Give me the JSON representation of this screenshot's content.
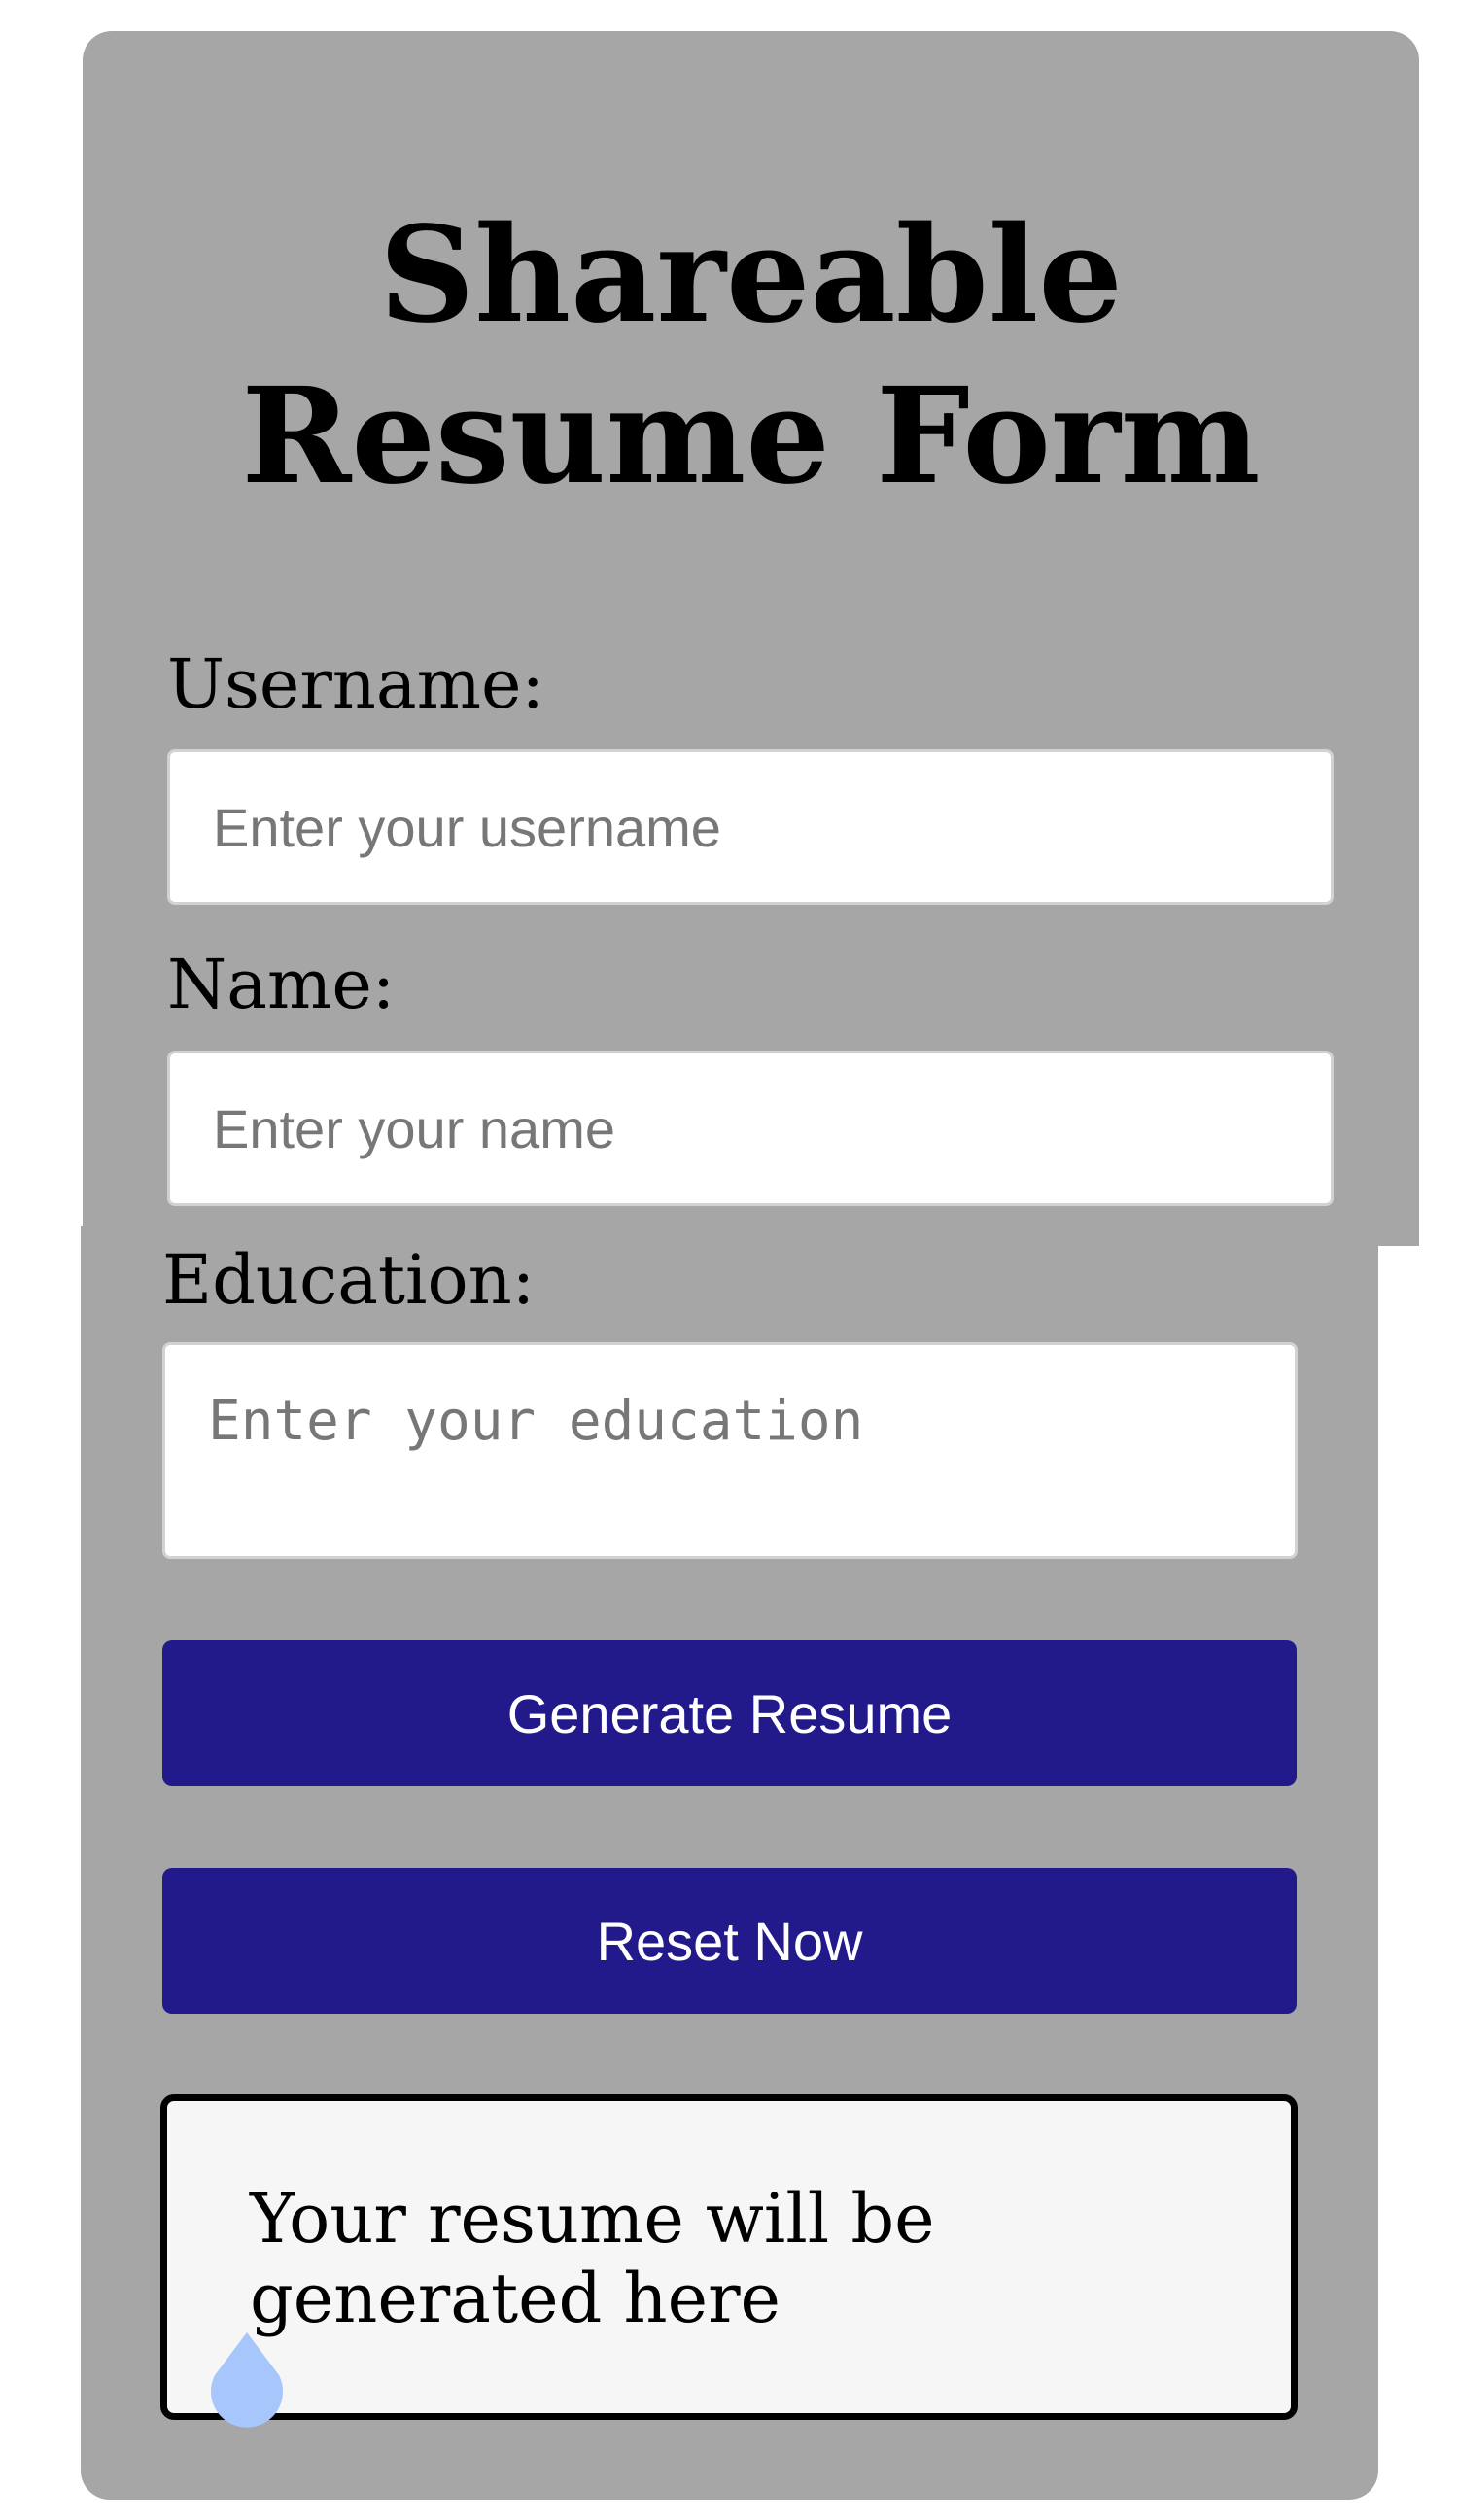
{
  "form": {
    "title": "Shareable Resume Form",
    "username": {
      "label": "Username:",
      "placeholder": "Enter your username",
      "value": ""
    },
    "name": {
      "label": "Name:",
      "placeholder": "Enter your name",
      "value": ""
    },
    "education": {
      "label": "Education:",
      "placeholder": "Enter your education",
      "value": ""
    },
    "generate_button": "Generate Resume",
    "reset_button": "Reset Now",
    "output_text": "Your resume will be generated here"
  },
  "theme": {
    "card_background": "#a6a6a6",
    "button_color": "#22198a",
    "cursor_handle_color": "#a7c6fb"
  },
  "icons": {
    "text_cursor_handle": "teardrop-handle"
  }
}
